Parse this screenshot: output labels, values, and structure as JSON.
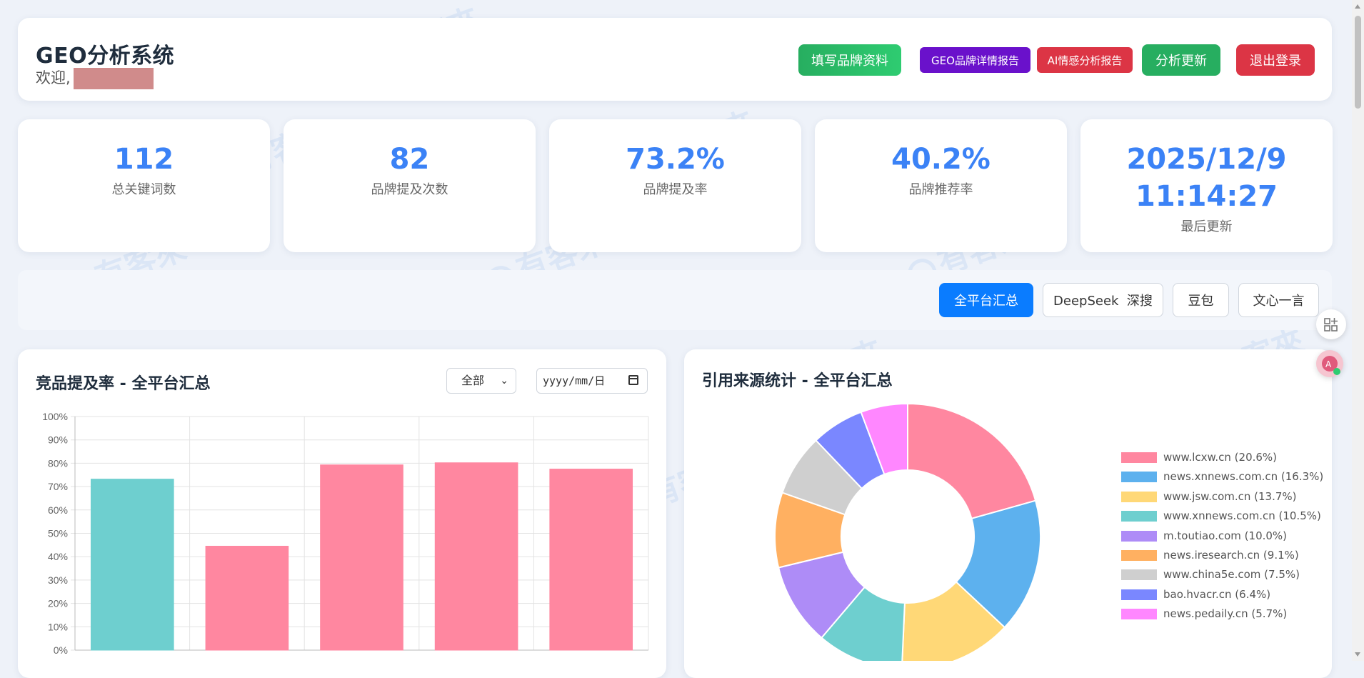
{
  "header": {
    "title": "GEO分析系统",
    "welcome": "欢迎,",
    "buttons": {
      "fill_brand": "填写品牌资料",
      "geo_report": "GEO品牌详情报告",
      "ai_report": "AI情感分析报告",
      "refresh": "分析更新",
      "logout": "退出登录"
    }
  },
  "stats": [
    {
      "value": "112",
      "label": "总关键词数"
    },
    {
      "value": "82",
      "label": "品牌提及次数"
    },
    {
      "value": "73.2%",
      "label": "品牌提及率"
    },
    {
      "value": "40.2%",
      "label": "品牌推荐率"
    },
    {
      "value_line1": "2025/12/9",
      "value_line2": "11:14:27",
      "label": "最后更新"
    }
  ],
  "tabs": [
    "全平台汇总",
    "DeepSeek  深搜",
    "豆包",
    "文心一言"
  ],
  "active_tab": "全平台汇总",
  "watermark_text": "有客來",
  "bar_panel": {
    "title": "竞品提及率 - 全平台汇总",
    "filter_selected": "全部",
    "date_placeholder": "yyyy/mm/日"
  },
  "pie_panel": {
    "title": "引用来源统计 - 全平台汇总"
  },
  "colors": {
    "primary_blue": "#3b82f6",
    "green": "#27ae60",
    "purple": "#6a11cb",
    "red": "#dc3545",
    "tab_active": "#0a7cff"
  },
  "chart_data": [
    {
      "type": "bar",
      "categories": [
        "",
        "",
        "",
        "",
        ""
      ],
      "values": [
        73.2,
        44.5,
        79.3,
        80.2,
        77.5
      ],
      "bar_colors": [
        "#6ecfcf",
        "#ff87a0",
        "#ff87a0",
        "#ff87a0",
        "#ff87a0"
      ],
      "yticks": [
        "0%",
        "10%",
        "20%",
        "30%",
        "40%",
        "50%",
        "60%",
        "70%",
        "80%",
        "90%",
        "100%"
      ],
      "ylim": [
        0,
        100
      ],
      "grid": true
    },
    {
      "type": "pie",
      "donut": true,
      "labels": [
        "www.lcxw.cn (20.6%)",
        "news.xnnews.com.cn (16.3%)",
        "www.jsw.com.cn (13.7%)",
        "www.xnnews.com.cn (10.5%)",
        "m.toutiao.com (10.0%)",
        "news.iresearch.cn (9.1%)",
        "www.china5e.com (7.5%)",
        "bao.hvacr.cn (6.4%)",
        "news.pedaily.cn (5.7%)"
      ],
      "values": [
        20.6,
        16.3,
        13.7,
        10.5,
        10.0,
        9.1,
        7.5,
        6.4,
        5.7
      ],
      "colors": [
        "#ff87a0",
        "#5db1ee",
        "#ffd877",
        "#6ecfcf",
        "#ae8cf7",
        "#ffb061",
        "#cfcfcf",
        "#7a87ff",
        "#ff87ff"
      ],
      "legend": "right"
    }
  ]
}
